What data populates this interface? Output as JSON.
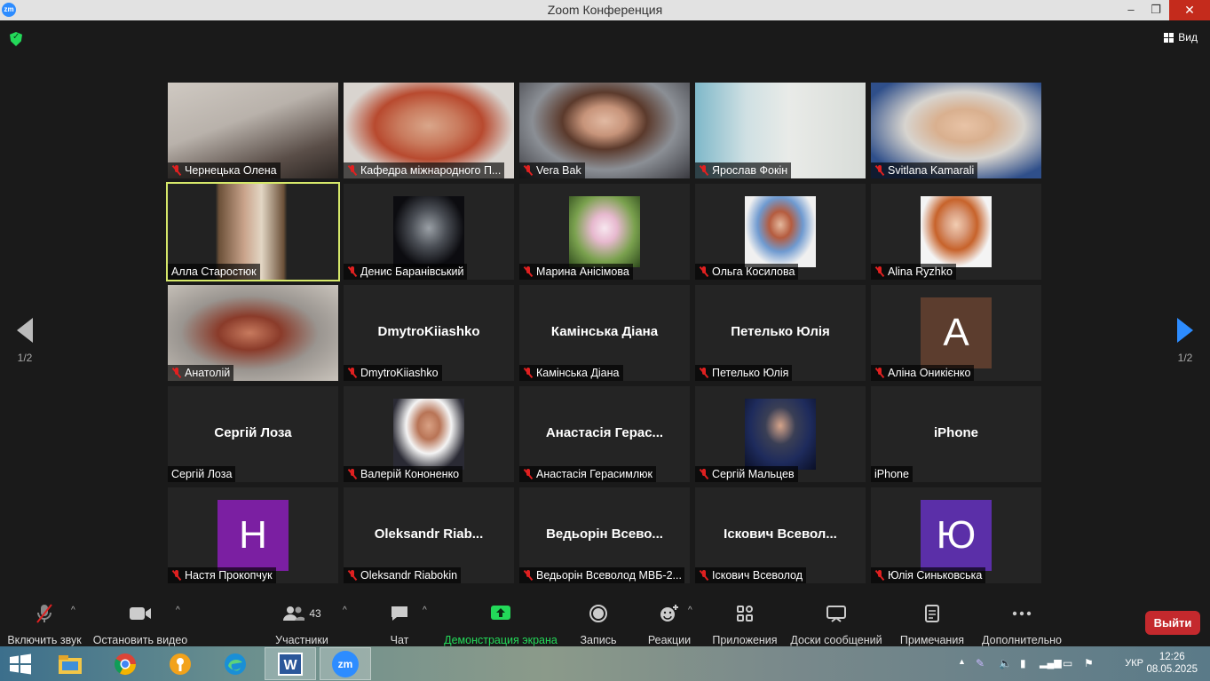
{
  "window": {
    "title": "Zoom Конференция",
    "app_icon": "zm",
    "minimize": "‒",
    "restore": "❐",
    "close": "✕"
  },
  "topbar": {
    "view_label": "Вид"
  },
  "pagination": {
    "left": "1/2",
    "right": "1/2"
  },
  "tiles": [
    {
      "label": "Чернецька Олена",
      "muted": true,
      "kind": "video"
    },
    {
      "label": "Кафедра міжнародного П...",
      "muted": true,
      "kind": "video"
    },
    {
      "label": "Vera Bak",
      "muted": true,
      "kind": "video"
    },
    {
      "label": "Ярослав Фокін",
      "muted": true,
      "kind": "video"
    },
    {
      "label": "Svitlana Kamarali",
      "muted": true,
      "kind": "video"
    },
    {
      "label": "Алла Старостюк",
      "muted": false,
      "kind": "video",
      "active": true
    },
    {
      "label": "Денис Баранівський",
      "muted": true,
      "kind": "avatar"
    },
    {
      "label": "Марина Анісімова",
      "muted": true,
      "kind": "avatar"
    },
    {
      "label": "Ольга Косилова",
      "muted": true,
      "kind": "avatar"
    },
    {
      "label": "Alina Ryzhko",
      "muted": true,
      "kind": "avatar"
    },
    {
      "label": "Анатолій",
      "muted": true,
      "kind": "video"
    },
    {
      "label": "DmytroKiiashko",
      "muted": true,
      "kind": "name",
      "big": "DmytroKiiashko"
    },
    {
      "label": "Камінська Діана",
      "muted": true,
      "kind": "name",
      "big": "Камінська Діана"
    },
    {
      "label": "Петелько Юлія",
      "muted": true,
      "kind": "name",
      "big": "Петелько Юлія"
    },
    {
      "label": "Аліна Оникієнко",
      "muted": true,
      "kind": "letter",
      "letter": "A",
      "color": "#5c3d2e"
    },
    {
      "label": "Сергій Лоза",
      "muted": false,
      "kind": "name",
      "big": "Сергій Лоза"
    },
    {
      "label": "Валерій Кононенко",
      "muted": true,
      "kind": "avatar"
    },
    {
      "label": "Анастасія Герасимлюк",
      "muted": true,
      "kind": "name",
      "big": "Анастасія  Герас..."
    },
    {
      "label": "Сергій Мальцев",
      "muted": true,
      "kind": "avatar"
    },
    {
      "label": "iPhone",
      "muted": false,
      "kind": "name",
      "big": "iPhone"
    },
    {
      "label": "Настя Прокопчук",
      "muted": true,
      "kind": "letter",
      "letter": "H",
      "color": "#7b1fa2"
    },
    {
      "label": "Oleksandr Riabokin",
      "muted": true,
      "kind": "name",
      "big": "Oleksandr  Riab..."
    },
    {
      "label": "Ведьорін Всеволод МВБ-2...",
      "muted": true,
      "kind": "name",
      "big": "Ведьорін  Всево..."
    },
    {
      "label": "Іскович Всеволод",
      "muted": true,
      "kind": "name",
      "big": "Іскович  Всевол..."
    },
    {
      "label": "Юлія Синьковська",
      "muted": true,
      "kind": "letter",
      "letter": "Ю",
      "color": "#5b2fa8"
    }
  ],
  "toolbar": {
    "unmute": "Включить звук",
    "stop_video": "Остановить видео",
    "participants": "Участники",
    "participants_count": "43",
    "chat": "Чат",
    "share": "Демонстрация экрана",
    "record": "Запись",
    "reactions": "Реакции",
    "apps": "Приложения",
    "whiteboards": "Доски сообщений",
    "notes": "Примечания",
    "more": "Дополнительно",
    "leave": "Выйти"
  },
  "taskbar": {
    "language": "УКР",
    "time": "12:26",
    "date": "08.05.2025",
    "zoom_label": "zm",
    "word_label": "W"
  },
  "colors": {
    "accent": "#2d8cff",
    "share_green": "#23d959",
    "leave_red": "#c4292d",
    "active_border": "#d6e86a"
  }
}
